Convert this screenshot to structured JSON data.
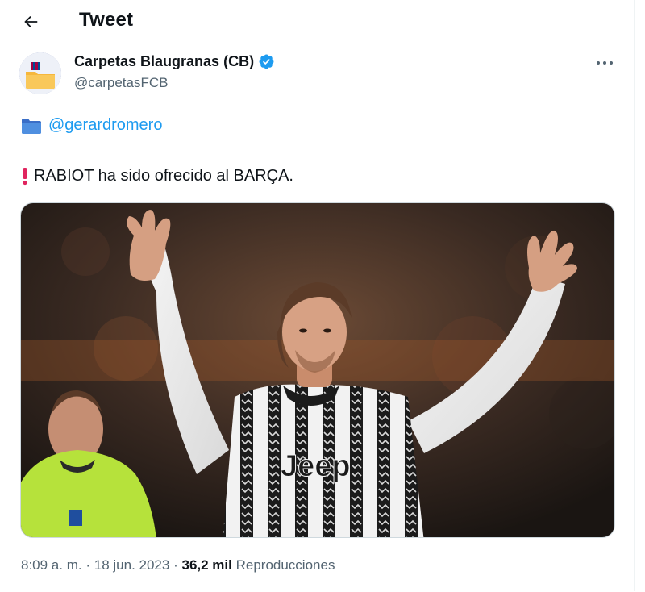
{
  "header": {
    "title": "Tweet",
    "back_icon": "arrow-left-icon"
  },
  "author": {
    "name": "Carpetas Blaugranas (CB)",
    "handle": "@carpetasFCB",
    "verified_color": "#1d9bf0",
    "avatar_bg": "#31479a",
    "avatar_folder_color": "#f6b73c"
  },
  "tweet": {
    "line1_icon": "folder-icon",
    "mention": "@gerardromero",
    "line2_icon": "exclamation-icon",
    "text": "RABIOT ha sido ofrecido al BARÇA.",
    "media_description_colors": {
      "jersey_stripe": "#1b1b1b",
      "referee_shirt": "#b6e23b"
    }
  },
  "meta": {
    "time": "8:09 a. m.",
    "separator": "·",
    "date": "18 jun. 2023",
    "views_count": "36,2 mil",
    "views_label": "Reproducciones"
  },
  "colors": {
    "accent": "#1d9bf0",
    "secondary_text": "#536471",
    "primary_text": "#0f1419",
    "exclamation": "#e0245e"
  }
}
